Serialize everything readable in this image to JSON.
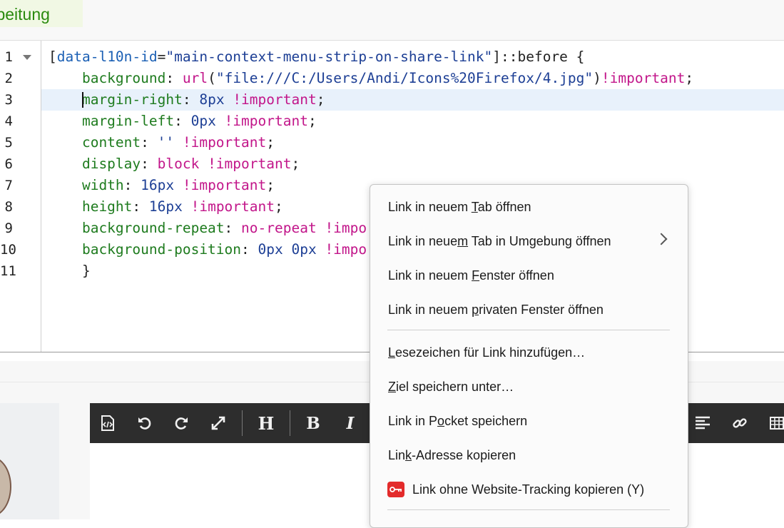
{
  "tab": {
    "label": "arbeitung"
  },
  "editor": {
    "line_numbers": [
      "1",
      "2",
      "3",
      "4",
      "5",
      "6",
      "7",
      "8",
      "9",
      "10",
      "11"
    ],
    "lines": [
      [
        {
          "t": "[",
          "c": "c-punc"
        },
        {
          "t": "data-l10n-id",
          "c": "c-sel"
        },
        {
          "t": "=",
          "c": "c-punc"
        },
        {
          "t": "\"main-context-menu-strip-on-share-link\"",
          "c": "c-str"
        },
        {
          "t": "]::before {",
          "c": "c-punc"
        }
      ],
      [
        {
          "t": "    background",
          "c": "c-prop"
        },
        {
          "t": ": ",
          "c": "c-punc"
        },
        {
          "t": "url",
          "c": "c-url"
        },
        {
          "t": "(",
          "c": "c-punc"
        },
        {
          "t": "\"file:///C:/Users/Andi/Icons%20Firefox/4.jpg\"",
          "c": "c-str"
        },
        {
          "t": ")",
          "c": "c-punc"
        },
        {
          "t": "!important",
          "c": "c-imp"
        },
        {
          "t": ";",
          "c": "c-punc"
        }
      ],
      [
        {
          "t": "margin-right",
          "c": "c-prop"
        },
        {
          "t": ": ",
          "c": "c-punc"
        },
        {
          "t": "8px",
          "c": "c-num"
        },
        {
          "t": " !important",
          "c": "c-imp"
        },
        {
          "t": ";",
          "c": "c-punc"
        }
      ],
      [
        {
          "t": "    margin-left",
          "c": "c-prop"
        },
        {
          "t": ": ",
          "c": "c-punc"
        },
        {
          "t": "0px",
          "c": "c-num"
        },
        {
          "t": " !important",
          "c": "c-imp"
        },
        {
          "t": ";",
          "c": "c-punc"
        }
      ],
      [
        {
          "t": "    content",
          "c": "c-prop"
        },
        {
          "t": ": ",
          "c": "c-punc"
        },
        {
          "t": "''",
          "c": "c-str"
        },
        {
          "t": " !important",
          "c": "c-imp"
        },
        {
          "t": ";",
          "c": "c-punc"
        }
      ],
      [
        {
          "t": "    display",
          "c": "c-prop"
        },
        {
          "t": ": ",
          "c": "c-punc"
        },
        {
          "t": "block",
          "c": "c-val"
        },
        {
          "t": " !important",
          "c": "c-imp"
        },
        {
          "t": ";",
          "c": "c-punc"
        }
      ],
      [
        {
          "t": "    width",
          "c": "c-prop"
        },
        {
          "t": ": ",
          "c": "c-punc"
        },
        {
          "t": "16px",
          "c": "c-num"
        },
        {
          "t": " !important",
          "c": "c-imp"
        },
        {
          "t": ";",
          "c": "c-punc"
        }
      ],
      [
        {
          "t": "    height",
          "c": "c-prop"
        },
        {
          "t": ": ",
          "c": "c-punc"
        },
        {
          "t": "16px",
          "c": "c-num"
        },
        {
          "t": " !important",
          "c": "c-imp"
        },
        {
          "t": ";",
          "c": "c-punc"
        }
      ],
      [
        {
          "t": "    background-repeat",
          "c": "c-prop"
        },
        {
          "t": ": ",
          "c": "c-punc"
        },
        {
          "t": "no-repeat",
          "c": "c-val"
        },
        {
          "t": " !impo",
          "c": "c-imp"
        }
      ],
      [
        {
          "t": "    background-position",
          "c": "c-prop"
        },
        {
          "t": ": ",
          "c": "c-punc"
        },
        {
          "t": "0px 0px",
          "c": "c-num"
        },
        {
          "t": " !impo",
          "c": "c-imp"
        }
      ],
      [
        {
          "t": "    }",
          "c": "c-punc"
        }
      ]
    ],
    "active_line_index": 2,
    "active_line_indent": "    "
  },
  "toolbar": {
    "buttons": [
      {
        "name": "source-code-icon",
        "glyph": "</>"
      },
      {
        "name": "undo-icon",
        "glyph": "↺"
      },
      {
        "name": "redo-icon",
        "glyph": "↻"
      },
      {
        "name": "fullscreen-icon",
        "glyph": "⤢"
      },
      {
        "name": "heading-icon",
        "glyph": "H"
      },
      {
        "name": "bold-icon",
        "glyph": "B"
      },
      {
        "name": "italic-icon",
        "glyph": "I"
      },
      {
        "name": "align-icon",
        "glyph": "≡"
      },
      {
        "name": "link-icon",
        "glyph": "🔗"
      },
      {
        "name": "table-icon",
        "glyph": "▦"
      }
    ]
  },
  "context_menu": {
    "items": [
      {
        "pre": "Link in neuem ",
        "acc": "T",
        "post": "ab öffnen"
      },
      {
        "pre": "Link in neue",
        "acc": "m",
        "post": " Tab in Umgebung öffnen"
      },
      {
        "pre": "Link in neuem ",
        "acc": "F",
        "post": "enster öffnen"
      },
      {
        "pre": "Link in neuem ",
        "acc": "p",
        "post": "rivaten Fenster öffnen"
      },
      {
        "pre": "",
        "acc": "L",
        "post": "esezeichen für Link hinzufügen…"
      },
      {
        "pre": "",
        "acc": "Z",
        "post": "iel speichern unter…"
      },
      {
        "pre": "Link in P",
        "acc": "o",
        "post": "cket speichern"
      },
      {
        "pre": "Lin",
        "acc": "k",
        "post": "-Adresse kopieren"
      },
      {
        "pre": "",
        "acc": "",
        "post": "Link ohne Website-Tracking kopieren (Y)"
      }
    ]
  }
}
